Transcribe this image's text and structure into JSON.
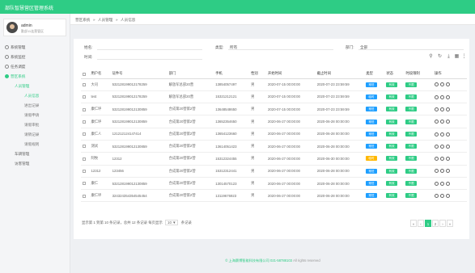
{
  "app": {
    "title": "部队智慧营区管理系统"
  },
  "user": {
    "name": "admin",
    "role": "勤部11连营管区"
  },
  "nav": [
    {
      "label": "系统管理",
      "level": 0,
      "active": false
    },
    {
      "label": "系统监控",
      "level": 0,
      "active": false
    },
    {
      "label": "任务调度",
      "level": 0,
      "active": false
    },
    {
      "label": "营区系统",
      "level": 0,
      "active": true
    },
    {
      "label": "人员管理",
      "level": 1,
      "active": true
    },
    {
      "label": "人员信息",
      "level": 2,
      "active": true
    },
    {
      "label": "进出记录",
      "level": 2,
      "active": false
    },
    {
      "label": "请假申请",
      "level": 2,
      "active": false
    },
    {
      "label": "请假审批",
      "level": 2,
      "active": false
    },
    {
      "label": "请销记录",
      "level": 2,
      "active": false
    },
    {
      "label": "请假规则",
      "level": 2,
      "active": false
    },
    {
      "label": "车辆管理",
      "level": 1,
      "active": false
    },
    {
      "label": "访客管理",
      "level": 1,
      "active": false
    }
  ],
  "breadcrumb": [
    "营区系统",
    "人员管理",
    "人员信息"
  ],
  "filters": {
    "name_label": "姓名:",
    "type_label": "类型:",
    "type_value": "所有",
    "dept_label": "部门:",
    "dept_value": "全部",
    "time_label": "时间:"
  },
  "table": {
    "headers": [
      "用户名",
      "证件号",
      "部门",
      "手机",
      "性别",
      "开始时间",
      "截止时间",
      "类型",
      "状态",
      "时段限制",
      "操作"
    ],
    "rows": [
      {
        "name": "大司",
        "id": "532128199012178259",
        "dept": "解放军总部20营",
        "phone": "13854057497",
        "gender": "男",
        "start": "2020-07-15 00:00:00",
        "end": "2020-07-23 23:59:59",
        "type": "常驻",
        "type_color": "#1e9fff",
        "status": "有效",
        "limit": "不限"
      },
      {
        "name": "test",
        "id": "532128199012178259",
        "dept": "解放军总部20营",
        "phone": "15321212121",
        "gender": "男",
        "start": "2020-07-15 00:00:00",
        "end": "2020-07-23 23:59:59",
        "type": "临时",
        "type_color": "#1e9fff",
        "status": "有效",
        "limit": "不限"
      },
      {
        "name": "康仁坪",
        "id": "532128199012130859",
        "dept": "合成第20营第2营",
        "phone": "13648548650",
        "gender": "男",
        "start": "2020-07-15 00:00:00",
        "end": "2020-07-23 23:59:59",
        "type": "常驻",
        "type_color": "#1e9fff",
        "status": "有效",
        "limit": "不限"
      },
      {
        "name": "康仁坪",
        "id": "532128199012130859",
        "dept": "合成第20营第2营",
        "phone": "13652354650",
        "gender": "男",
        "start": "2020-06-27 00:00:00",
        "end": "2020-06-28 00:00:00",
        "type": "常驻",
        "type_color": "#1e9fff",
        "status": "有效",
        "limit": "不限"
      },
      {
        "name": "康仁人",
        "id": "121212124147414",
        "dept": "合成第20营第2营",
        "phone": "13654123660",
        "gender": "男",
        "start": "2020-06-27 00:00:00",
        "end": "2020-06-28 00:00:00",
        "type": "常驻",
        "type_color": "#1e9fff",
        "status": "有效",
        "limit": "不限"
      },
      {
        "name": "测试",
        "id": "532128199012130859",
        "dept": "合成第20营第2营",
        "phone": "13614051423",
        "gender": "男",
        "start": "2020-06-27 00:00:00",
        "end": "2020-06-28 00:00:00",
        "type": "常驻",
        "type_color": "#1e9fff",
        "status": "有效",
        "limit": "不限"
      },
      {
        "name": "阿牧",
        "id": "12312",
        "dept": "合成第20营第2营",
        "phone": "15312324455",
        "gender": "男",
        "start": "2020-06-27 00:00:00",
        "end": "2020-06-30 00:00:00",
        "type": "临时",
        "type_color": "#ffb800",
        "status": "有效",
        "limit": "不限"
      },
      {
        "name": "12312",
        "id": "123456",
        "dept": "合成第20营第2营",
        "phone": "15312312441",
        "gender": "男",
        "start": "2020-06-27 00:00:00",
        "end": "2020-06-28 00:00:00",
        "type": "常驻",
        "type_color": "#1e9fff",
        "status": "有效",
        "limit": "不限"
      },
      {
        "name": "康仁",
        "id": "532128199012130859",
        "dept": "合成第20营第2营",
        "phone": "13014570123",
        "gender": "男",
        "start": "2020-06-27 00:00:00",
        "end": "2020-06-28 00:00:00",
        "type": "常驻",
        "type_color": "#1e9fff",
        "status": "有效",
        "limit": "不限"
      },
      {
        "name": "康仁坪",
        "id": "324324354354545454",
        "dept": "合成第20营第2营",
        "phone": "13119676923",
        "gender": "男",
        "start": "2020-06-27 00:00:00",
        "end": "2020-06-28 00:00:00",
        "type": "常驻",
        "type_color": "#1e9fff",
        "status": "有效",
        "limit": "不限"
      }
    ]
  },
  "pagination": {
    "info_prefix": "显示第 1 到第 10 条记录，总共 12 条记录 每页显示",
    "page_size": "10 ▼",
    "info_suffix": "条记录",
    "pages": [
      "‹",
      "1",
      "2",
      "›",
      "»"
    ],
    "first": "«",
    "current": "1"
  },
  "footer": {
    "brand": "© 上海赛博智能科技有限公司",
    "phone": "021-58788103",
    "rights": "All rights reserved"
  },
  "colors": {
    "accent": "#2ecc85",
    "blue": "#1e9fff",
    "orange": "#ffb800"
  }
}
